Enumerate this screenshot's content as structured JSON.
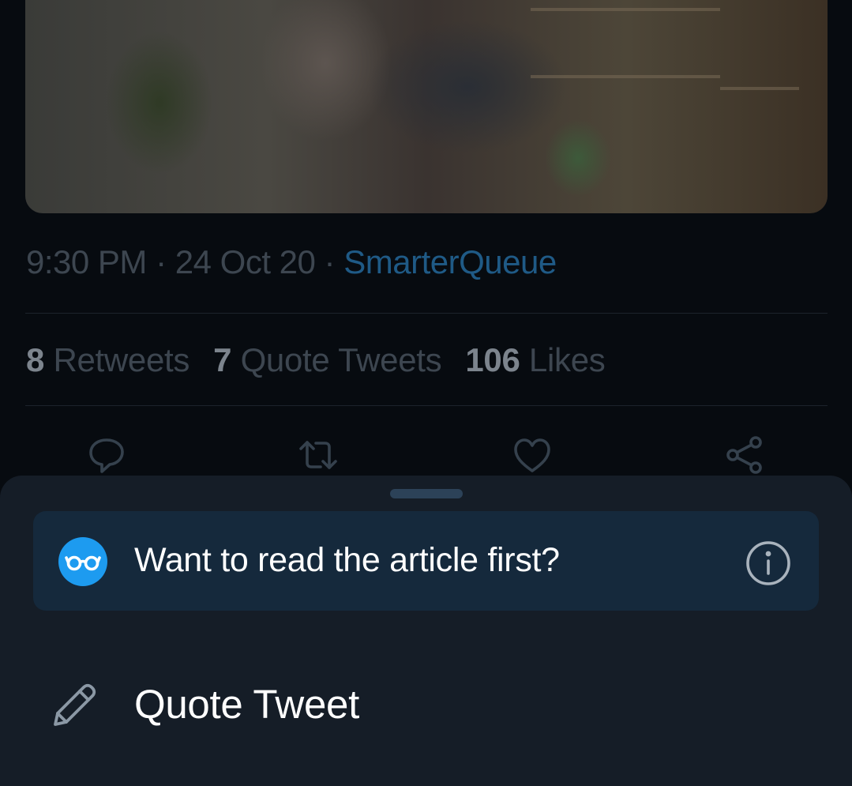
{
  "tweet": {
    "time": "9:30 PM",
    "date": "24 Oct 20",
    "separator": "·",
    "source": "SmarterQueue"
  },
  "stats": {
    "retweets_count": "8",
    "retweets_label": "Retweets",
    "quote_tweets_count": "7",
    "quote_tweets_label": "Quote Tweets",
    "likes_count": "106",
    "likes_label": "Likes"
  },
  "actions": {
    "icons": [
      "reply-icon",
      "retweet-icon",
      "like-icon",
      "share-icon"
    ]
  },
  "sheet": {
    "article_prompt": "Want to read the article first?",
    "quote_tweet_label": "Quote Tweet"
  },
  "colors": {
    "accent": "#1d9bf0",
    "background": "#070b10",
    "sheet": "#151d27",
    "prompt_card": "#15293c",
    "link": "#1f5a86"
  }
}
